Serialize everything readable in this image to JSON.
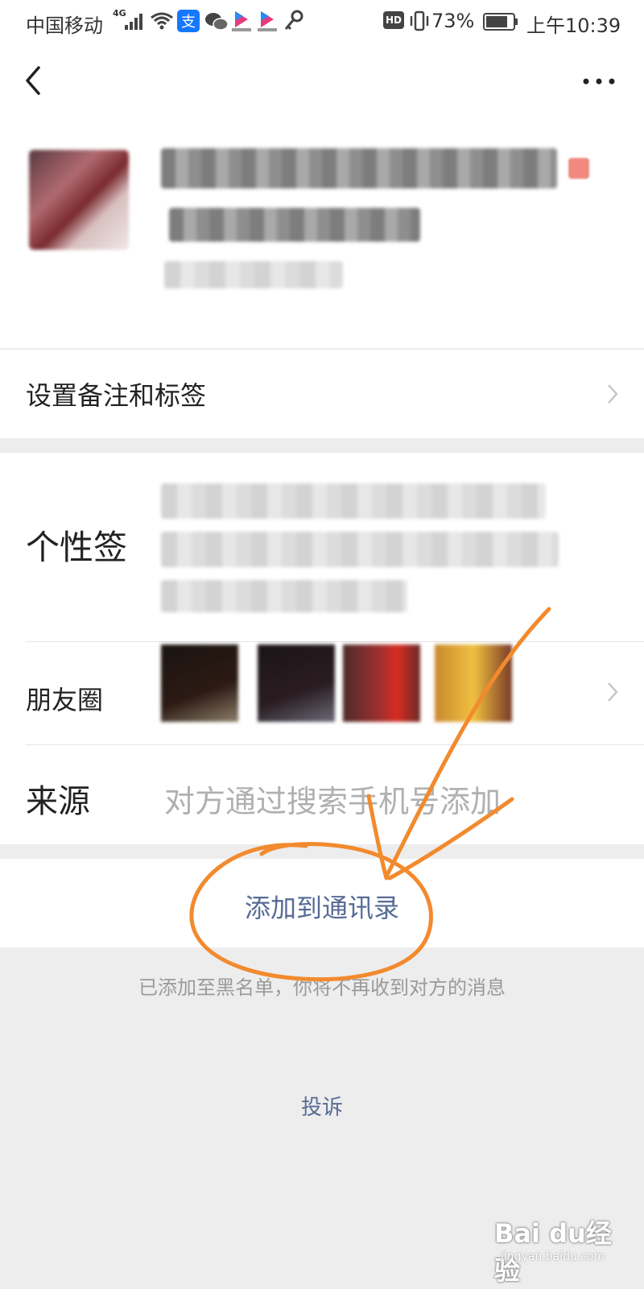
{
  "status_bar": {
    "carrier": "中国移动",
    "network": "4G",
    "battery": "73%",
    "time": "上午10:39",
    "icons": [
      "signal-icon",
      "wifi-icon",
      "alipay-icon",
      "wechat-icon",
      "youku-icon",
      "youku-icon",
      "key-icon",
      "hd-icon",
      "vibrate-icon",
      "battery-icon"
    ]
  },
  "header": {
    "back_icon": "chevron-left-icon",
    "more_icon": "more-dots-icon"
  },
  "profile": {
    "avatar": "avatar (pixelated)"
  },
  "remark_row": {
    "label": "设置备注和标签"
  },
  "info": {
    "signature_label": "个性签",
    "moments_label": "朋友圈",
    "source_label": "来源",
    "source_value": "对方通过搜索手机号添加"
  },
  "actions": {
    "add_contact": "添加到通讯录",
    "blacklist_notice": "已添加至黑名单，你将不再收到对方的消息",
    "report": "投诉"
  },
  "watermark": {
    "main": "Bai du经验",
    "sub": "jingyan.baidu.com"
  },
  "colors": {
    "link": "#576b95",
    "background": "#ededed",
    "annotation": "#f28a2e"
  }
}
